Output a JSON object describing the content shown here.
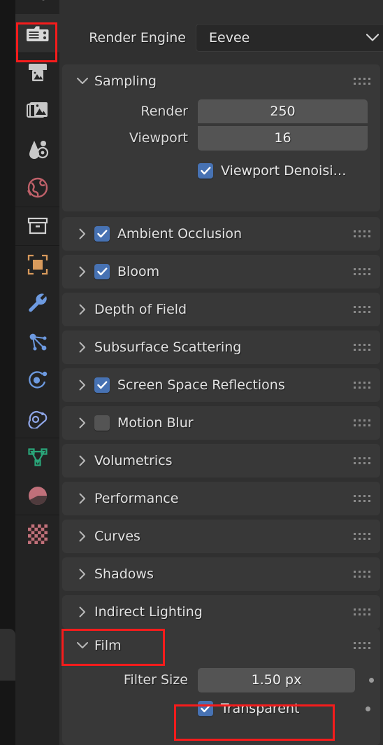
{
  "app": {
    "name": "Blender Render Properties",
    "colors": {
      "background": "#1d1d1d",
      "panel": "#383838",
      "panel_body": "#303030",
      "tab_column": "#232323",
      "accent_checkbox": "#4772b3",
      "highlight": "#f51c1c",
      "field": "#545454",
      "text": "#e3e3e3"
    }
  },
  "tab_column": {
    "items": [
      {
        "name": "tool-tab",
        "icon": "tool-icon",
        "active": false,
        "color": "#c8c8c8"
      },
      {
        "name": "render-tab",
        "icon": "camera-back-icon",
        "active": true,
        "color": "#d8d8d8"
      },
      {
        "name": "output-tab",
        "icon": "printer-icon",
        "active": false,
        "color": "#c8c8c8"
      },
      {
        "name": "view-layer-tab",
        "icon": "images-stack-icon",
        "active": false,
        "color": "#c8c8c8"
      },
      {
        "name": "scene-tab",
        "icon": "scene-cone-icon",
        "active": false,
        "color": "#c8c8c8"
      },
      {
        "name": "world-tab",
        "icon": "world-globe-icon",
        "active": false,
        "color": "#c0616a"
      },
      {
        "name": "collection-tab",
        "icon": "box-collection-icon",
        "active": false,
        "color": "#d0d0d0"
      },
      {
        "name": "object-tab",
        "icon": "object-square-icon",
        "active": false,
        "color": "#d89a5c"
      },
      {
        "name": "modifier-tab",
        "icon": "wrench-icon",
        "active": false,
        "color": "#6d9ae0"
      },
      {
        "name": "particles-tab",
        "icon": "particles-icon",
        "active": false,
        "color": "#6d9ae0"
      },
      {
        "name": "physics-tab",
        "icon": "physics-orbit-icon",
        "active": false,
        "color": "#6d9ae0"
      },
      {
        "name": "constraints-tab",
        "icon": "constraint-icon",
        "active": false,
        "color": "#8fa6e8"
      },
      {
        "name": "object-data-tab",
        "icon": "mesh-data-icon",
        "active": false,
        "color": "#2aa67a"
      },
      {
        "name": "material-tab",
        "icon": "material-sphere-icon",
        "active": false,
        "color": "#c0707a"
      },
      {
        "name": "texture-tab",
        "icon": "checker-texture-icon",
        "active": false,
        "color": "#c0707a"
      }
    ]
  },
  "header": {
    "render_engine_label": "Render Engine",
    "render_engine_value": "Eevee"
  },
  "sampling": {
    "title": "Sampling",
    "expanded": true,
    "render_label": "Render",
    "render_value": "250",
    "viewport_label": "Viewport",
    "viewport_value": "16",
    "viewport_denoising_label": "Viewport Denoisi…",
    "viewport_denoising_checked": true
  },
  "sections": [
    {
      "title": "Ambient Occlusion",
      "has_checkbox": true,
      "checked": true,
      "expanded": false
    },
    {
      "title": "Bloom",
      "has_checkbox": true,
      "checked": true,
      "expanded": false
    },
    {
      "title": "Depth of Field",
      "has_checkbox": false,
      "checked": false,
      "expanded": false
    },
    {
      "title": "Subsurface Scattering",
      "has_checkbox": false,
      "checked": false,
      "expanded": false
    },
    {
      "title": "Screen Space Reflections",
      "has_checkbox": true,
      "checked": true,
      "expanded": false
    },
    {
      "title": "Motion Blur",
      "has_checkbox": true,
      "checked": false,
      "expanded": false
    },
    {
      "title": "Volumetrics",
      "has_checkbox": false,
      "checked": false,
      "expanded": false
    },
    {
      "title": "Performance",
      "has_checkbox": false,
      "checked": false,
      "expanded": false
    },
    {
      "title": "Curves",
      "has_checkbox": false,
      "checked": false,
      "expanded": false
    },
    {
      "title": "Shadows",
      "has_checkbox": false,
      "checked": false,
      "expanded": false
    },
    {
      "title": "Indirect Lighting",
      "has_checkbox": false,
      "checked": false,
      "expanded": false
    }
  ],
  "film": {
    "title": "Film",
    "expanded": true,
    "filter_size_label": "Filter Size",
    "filter_size_value": "1.50 px",
    "transparent_label": "Transparent",
    "transparent_checked": true
  },
  "annotations": [
    {
      "name": "highlight-render-tab",
      "target": "render-tab"
    },
    {
      "name": "highlight-film-header",
      "target": "film-panel-header"
    },
    {
      "name": "highlight-transparent",
      "target": "transparent-checkbox-row"
    }
  ]
}
